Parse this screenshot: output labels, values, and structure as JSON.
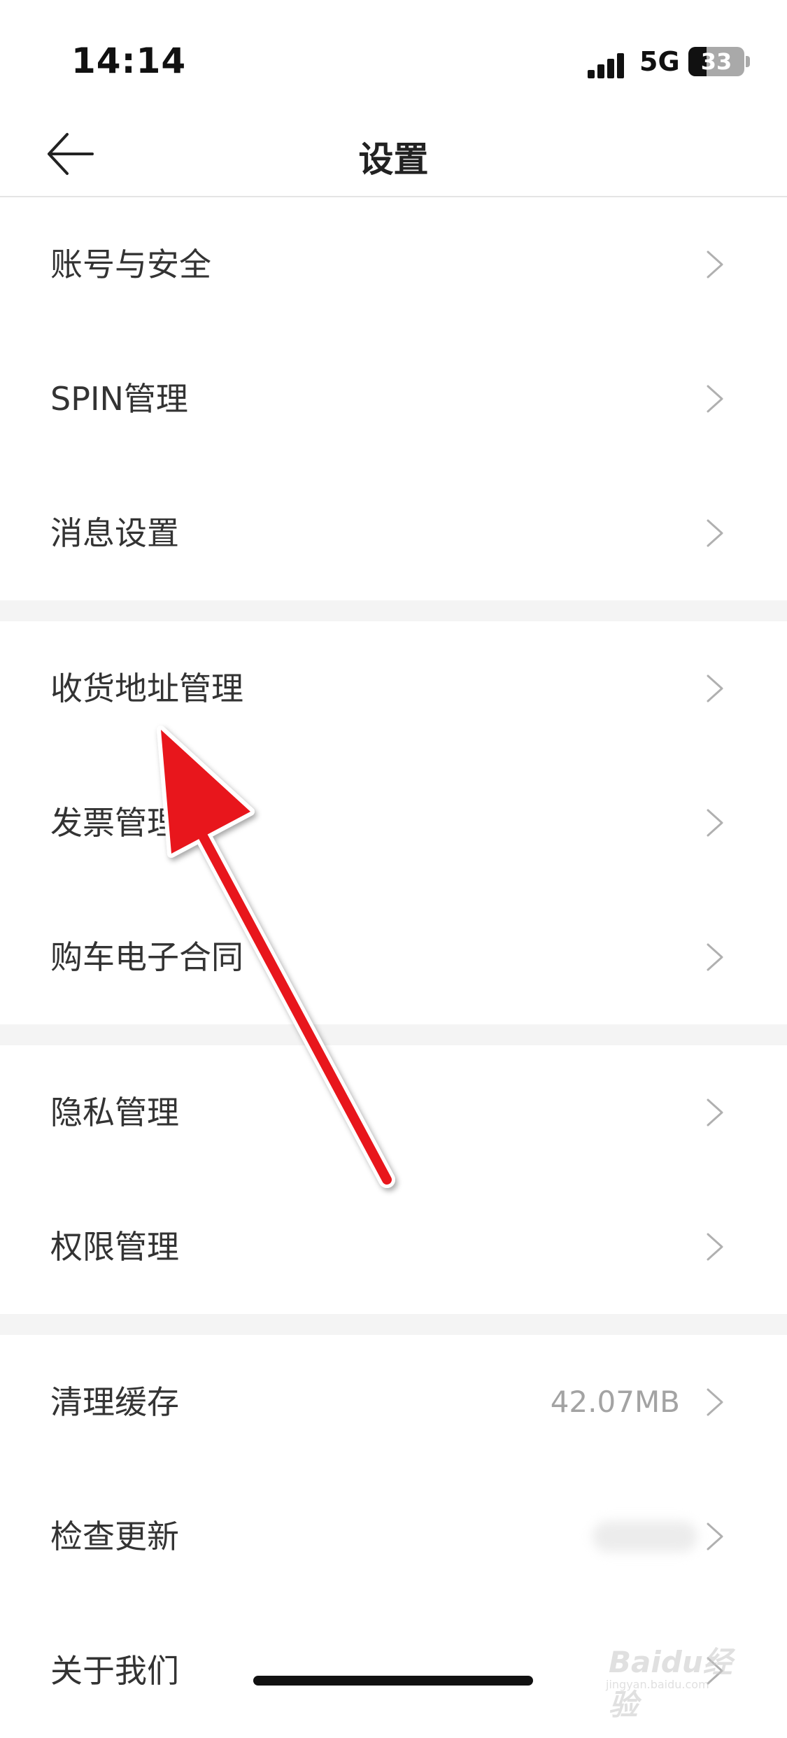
{
  "status_bar": {
    "time": "14:14",
    "network": "5G",
    "battery_level": "33"
  },
  "nav": {
    "back_icon": "arrow-left-icon",
    "title": "设置"
  },
  "sections": [
    {
      "items": [
        {
          "id": "account-security",
          "label": "账号与安全"
        },
        {
          "id": "spin-management",
          "label": "SPIN管理"
        },
        {
          "id": "message-settings",
          "label": "消息设置"
        }
      ]
    },
    {
      "items": [
        {
          "id": "shipping-address",
          "label": "收货地址管理"
        },
        {
          "id": "invoice-management",
          "label": "发票管理"
        },
        {
          "id": "purchase-contract",
          "label": "购车电子合同"
        }
      ]
    },
    {
      "items": [
        {
          "id": "privacy-management",
          "label": "隐私管理"
        },
        {
          "id": "permission-management",
          "label": "权限管理"
        }
      ]
    },
    {
      "items": [
        {
          "id": "clear-cache",
          "label": "清理缓存",
          "value": "42.07MB"
        },
        {
          "id": "check-update",
          "label": "检查更新",
          "value_blurred": true
        },
        {
          "id": "about-us",
          "label": "关于我们"
        }
      ]
    }
  ],
  "row_icon": "chevron-right-icon",
  "annotation": {
    "icon": "red-arrow-icon",
    "color": "#e8141b",
    "points_to": "收货地址管理"
  },
  "watermark": {
    "logo": "Baidu经验",
    "url": "jingyan.baidu.com"
  }
}
